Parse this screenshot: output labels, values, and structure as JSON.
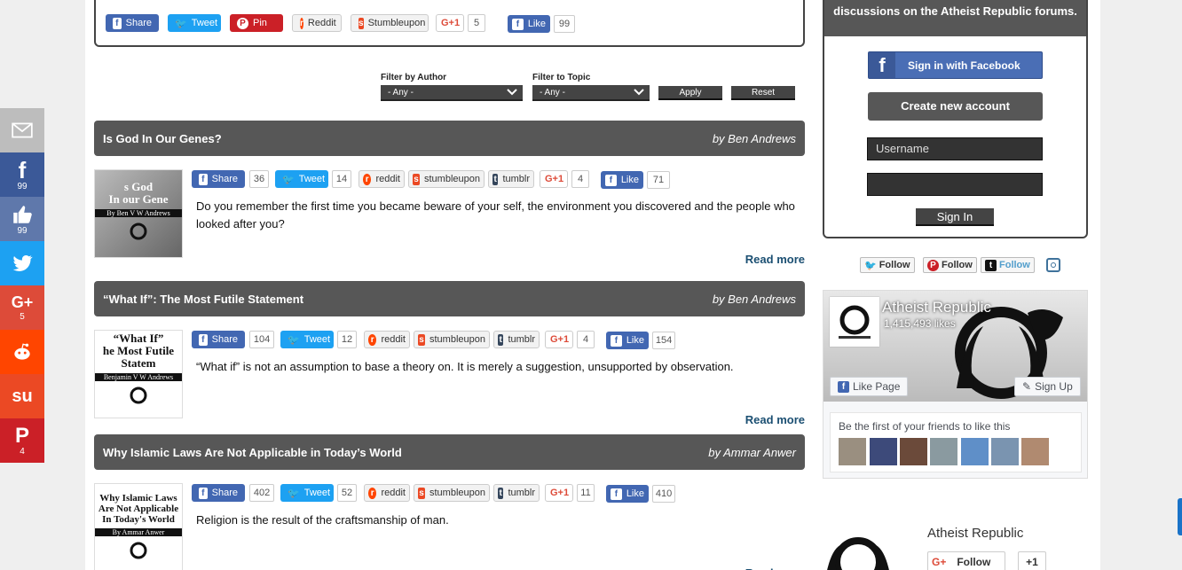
{
  "floatbar": {
    "items": [
      {
        "name": "email",
        "count": ""
      },
      {
        "name": "facebook",
        "count": "99"
      },
      {
        "name": "like",
        "count": "99"
      },
      {
        "name": "twitter",
        "count": ""
      },
      {
        "name": "googleplus",
        "count": "5"
      },
      {
        "name": "reddit",
        "count": ""
      },
      {
        "name": "stumbleupon",
        "count": ""
      },
      {
        "name": "pinterest",
        "count": "4"
      }
    ],
    "colors": {
      "email": "#bdbdbd",
      "facebook": "#3b5998",
      "like": "#5f78ab",
      "twitter": "#1da1f2",
      "googleplus": "#dd4b39",
      "reddit": "#ff4500",
      "stumbleupon": "#eb4924",
      "pinterest": "#cb2027"
    }
  },
  "topshare": {
    "share": "Share",
    "tweet": "Tweet",
    "pin": "Pin",
    "reddit": "Reddit",
    "stumble": "Stumbleupon",
    "gplus": "G+1",
    "gplus_count": "5",
    "like": "Like",
    "like_count": "99"
  },
  "filter": {
    "author_label": "Filter by Author",
    "author_value": "- Any -",
    "topic_label": "Filter to Topic",
    "topic_value": "- Any -",
    "apply": "Apply",
    "reset": "Reset"
  },
  "labels": {
    "share": "Share",
    "tweet": "Tweet",
    "reddit": "reddit",
    "stumble": "stumbleupon",
    "tumblr": "tumblr",
    "gplus": "G+1",
    "like": "Like",
    "readmore": "Read more"
  },
  "articles": [
    {
      "title": "Is God In Our Genes?",
      "author": "by Ben Andrews",
      "share_count": "36",
      "tweet_count": "14",
      "gplus_count": "4",
      "like_count": "71",
      "excerpt": "Do you remember the first time you became beware of your self, the environment you discovered and the people who looked after you?",
      "thumb_lines": [
        "s God",
        "In our Gene"
      ],
      "thumb_byline": "By Ben V W Andrews"
    },
    {
      "title": "“What If”: The Most Futile Statement",
      "author": "by Ben Andrews",
      "share_count": "104",
      "tweet_count": "12",
      "gplus_count": "4",
      "like_count": "154",
      "excerpt": "“What if” is not an assumption to base a theory on. It is merely a suggestion, unsupported by observation.",
      "thumb_lines": [
        "“What If”",
        "he Most Futile Statem"
      ],
      "thumb_byline": "Benjamin V W Andrews"
    },
    {
      "title": "Why Islamic Laws Are Not Applicable in Today’s World",
      "author": "by Ammar Anwer",
      "share_count": "402",
      "tweet_count": "52",
      "gplus_count": "11",
      "like_count": "410",
      "excerpt": "Religion is the result of the craftsmanship of man.",
      "thumb_lines": [
        "Why Islamic Laws",
        "Are Not Applicable",
        "In Today's World"
      ],
      "thumb_byline": "By Ammar Anwer"
    }
  ],
  "sidebar": {
    "heading": "discussions on the Atheist Republic forums.",
    "fb_signin": "Sign in with Facebook",
    "create": "Create new account",
    "username_placeholder": "Username",
    "signin": "Sign In",
    "follow_twitter": "Follow",
    "follow_pinterest": "Follow",
    "follow_tumblr": "Follow",
    "page_name": "Atheist Republic",
    "page_likes": "1,415,493 likes",
    "like_page": "Like Page",
    "sign_up": "Sign Up",
    "friends_text": "Be the first of your friends to like this",
    "gplus_name": "Atheist Republic",
    "gplus_follow": "Follow",
    "gplus_plus": "+1"
  }
}
